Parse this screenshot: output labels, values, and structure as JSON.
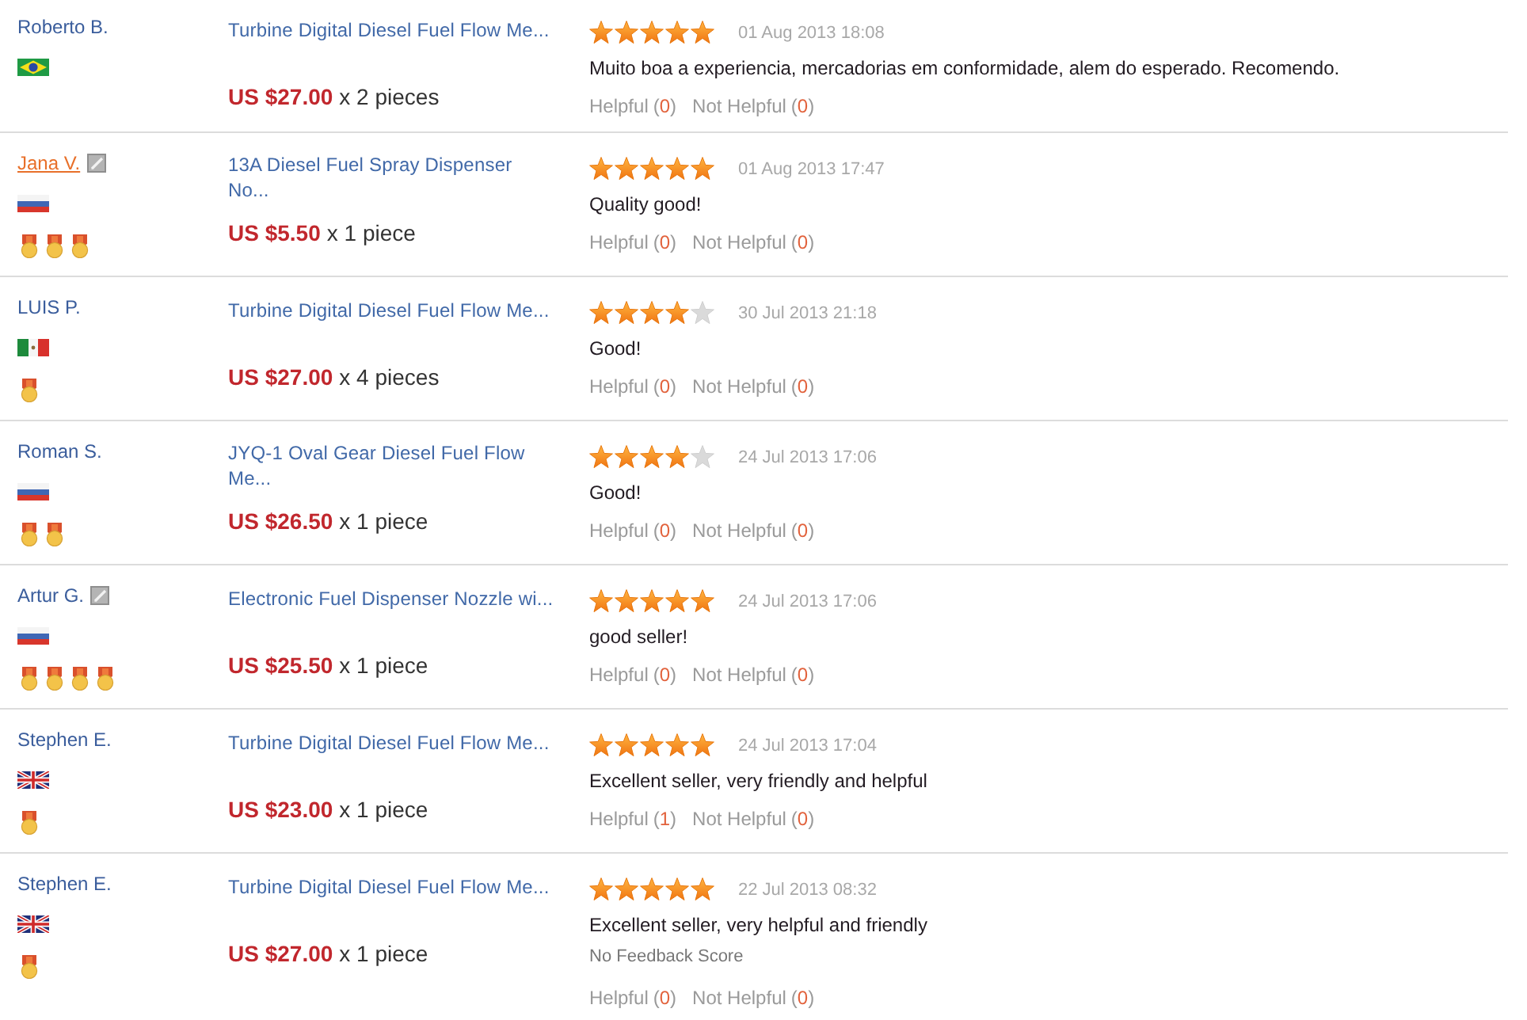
{
  "reviews": [
    {
      "buyer": {
        "name": "Roberto B.",
        "hovered": false,
        "note_icon": false,
        "flag": {
          "kind": "brazil"
        }
      },
      "product": {
        "title": "Turbine Digital Diesel Fuel Flow Me...",
        "price": "US $27.00",
        "quantity": "x 2 pieces"
      },
      "stars": 5,
      "date": "01 Aug 2013 18:08",
      "text": "Muito boa a experiencia, mercadorias em conformidade, alem do esperado. Recomendo.",
      "helpful": {
        "label": "Helpful",
        "count": "(0)"
      },
      "not_helpful": {
        "label": "Not Helpful",
        "count": "(0)"
      }
    },
    {
      "buyer": {
        "name": "Jana V.",
        "hovered": true,
        "note_icon": true,
        "flag": {
          "kind": "russia"
        },
        "medals": [
          {
            "kind": "gold"
          },
          {
            "kind": "gold"
          },
          {
            "kind": "gold"
          }
        ]
      },
      "product": {
        "title": "13A Diesel Fuel Spray Dispenser No...",
        "price": "US $5.50",
        "quantity": "x 1 piece"
      },
      "stars": 5,
      "date": "01 Aug 2013 17:47",
      "text": "Quality good!",
      "helpful": {
        "label": "Helpful",
        "count": "(0)"
      },
      "not_helpful": {
        "label": "Not Helpful",
        "count": "(0)"
      }
    },
    {
      "buyer": {
        "name": "LUIS P.",
        "hovered": false,
        "note_icon": false,
        "flag": {
          "kind": "mexico"
        },
        "medals": [
          {
            "kind": "gold"
          }
        ]
      },
      "product": {
        "title": "Turbine Digital Diesel Fuel Flow Me...",
        "price": "US $27.00",
        "quantity": "x 4 pieces"
      },
      "stars": 4,
      "date": "30 Jul 2013 21:18",
      "text": "Good!",
      "helpful": {
        "label": "Helpful",
        "count": "(0)"
      },
      "not_helpful": {
        "label": "Not Helpful",
        "count": "(0)"
      }
    },
    {
      "buyer": {
        "name": "Roman S.",
        "hovered": false,
        "note_icon": false,
        "flag": {
          "kind": "russia"
        },
        "medals": [
          {
            "kind": "gold"
          },
          {
            "kind": "gold"
          }
        ]
      },
      "product": {
        "title": "JYQ-1 Oval Gear Diesel Fuel Flow Me...",
        "price": "US $26.50",
        "quantity": "x 1 piece"
      },
      "stars": 4,
      "date": "24 Jul 2013 17:06",
      "text": "Good!",
      "helpful": {
        "label": "Helpful",
        "count": "(0)"
      },
      "not_helpful": {
        "label": "Not Helpful",
        "count": "(0)"
      }
    },
    {
      "buyer": {
        "name": "Artur G.",
        "hovered": false,
        "note_icon": true,
        "flag": {
          "kind": "russia"
        },
        "medals": [
          {
            "kind": "gold"
          },
          {
            "kind": "gold"
          },
          {
            "kind": "gold"
          },
          {
            "kind": "gold"
          }
        ]
      },
      "product": {
        "title": "Electronic Fuel Dispenser Nozzle wi...",
        "price": "US $25.50",
        "quantity": "x 1 piece"
      },
      "stars": 5,
      "date": "24 Jul 2013 17:06",
      "text": "good seller!",
      "helpful": {
        "label": "Helpful",
        "count": "(0)"
      },
      "not_helpful": {
        "label": "Not Helpful",
        "count": "(0)"
      }
    },
    {
      "buyer": {
        "name": "Stephen E.",
        "hovered": false,
        "note_icon": false,
        "flag": {
          "kind": "uk"
        },
        "medals": [
          {
            "kind": "gold"
          }
        ]
      },
      "product": {
        "title": "Turbine Digital Diesel Fuel Flow Me...",
        "price": "US $23.00",
        "quantity": "x 1 piece"
      },
      "stars": 5,
      "date": "24 Jul 2013 17:04",
      "text": "Excellent seller, very friendly and helpful",
      "helpful": {
        "label": "Helpful",
        "count": "(1)"
      },
      "not_helpful": {
        "label": "Not Helpful",
        "count": "(0)"
      }
    },
    {
      "buyer": {
        "name": "Stephen E.",
        "hovered": false,
        "note_icon": false,
        "flag": {
          "kind": "uk"
        },
        "medals": [
          {
            "kind": "gold"
          }
        ]
      },
      "product": {
        "title": "Turbine Digital Diesel Fuel Flow Me...",
        "price": "US $27.00",
        "quantity": "x 1 piece"
      },
      "stars": 5,
      "date": "22 Jul 2013 08:32",
      "text": "Excellent seller, very helpful and friendly",
      "score_note": "No Feedback Score",
      "helpful": {
        "label": "Helpful",
        "count": "(0)"
      },
      "not_helpful": {
        "label": "Not Helpful",
        "count": "(0)"
      }
    }
  ]
}
